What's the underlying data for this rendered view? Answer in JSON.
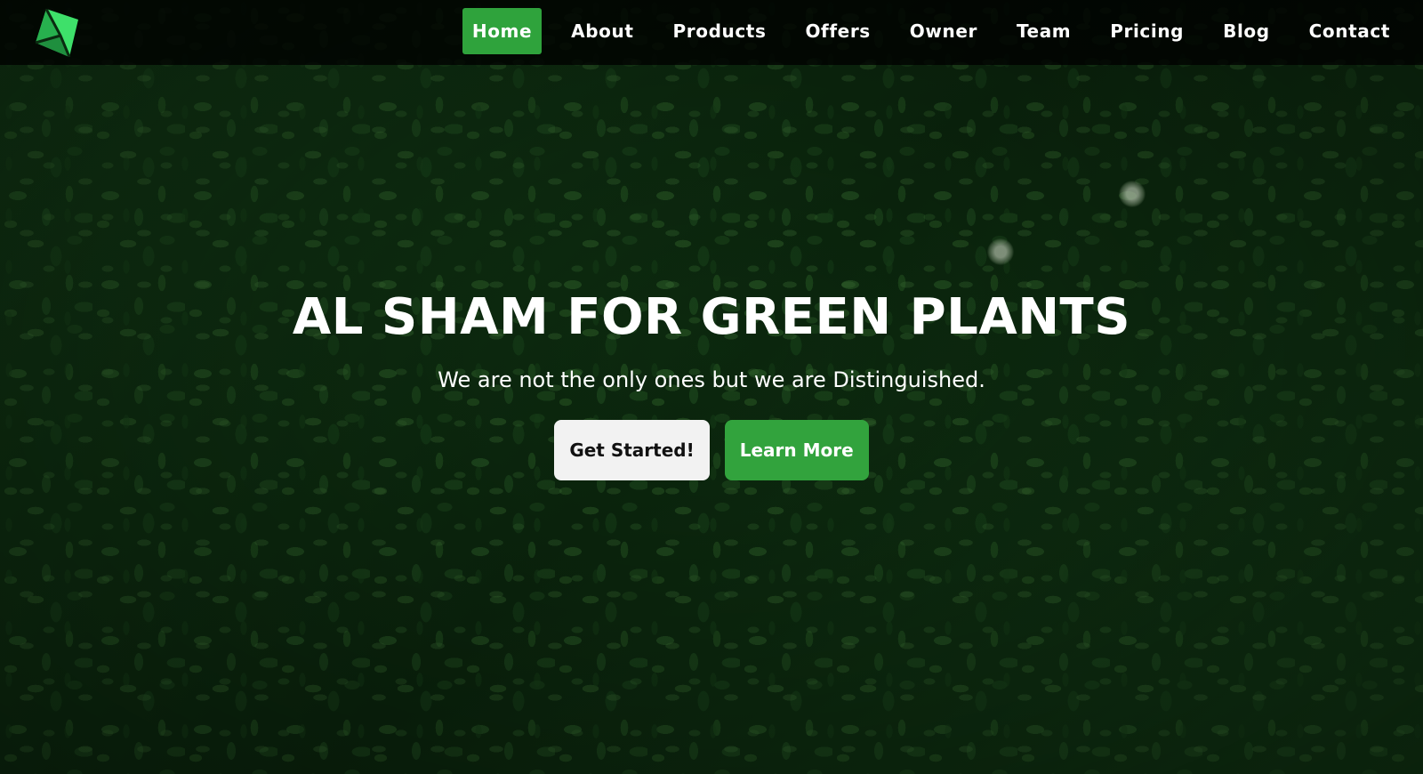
{
  "brand": {
    "logo_icon": "green-diamond-logo-icon",
    "accent_color": "#2fa33c"
  },
  "nav": {
    "items": [
      {
        "label": "Home",
        "active": true
      },
      {
        "label": "About",
        "active": false
      },
      {
        "label": "Products",
        "active": false
      },
      {
        "label": "Offers",
        "active": false
      },
      {
        "label": "Owner",
        "active": false
      },
      {
        "label": "Team",
        "active": false
      },
      {
        "label": "Pricing",
        "active": false
      },
      {
        "label": "Blog",
        "active": false
      },
      {
        "label": "Contact",
        "active": false
      }
    ]
  },
  "hero": {
    "title": "AL SHAM FOR GREEN PLANTS",
    "subtitle": "We are not the only ones but we are Distinguished.",
    "buttons": {
      "get_started": "Get Started!",
      "learn_more": "Learn More"
    }
  }
}
